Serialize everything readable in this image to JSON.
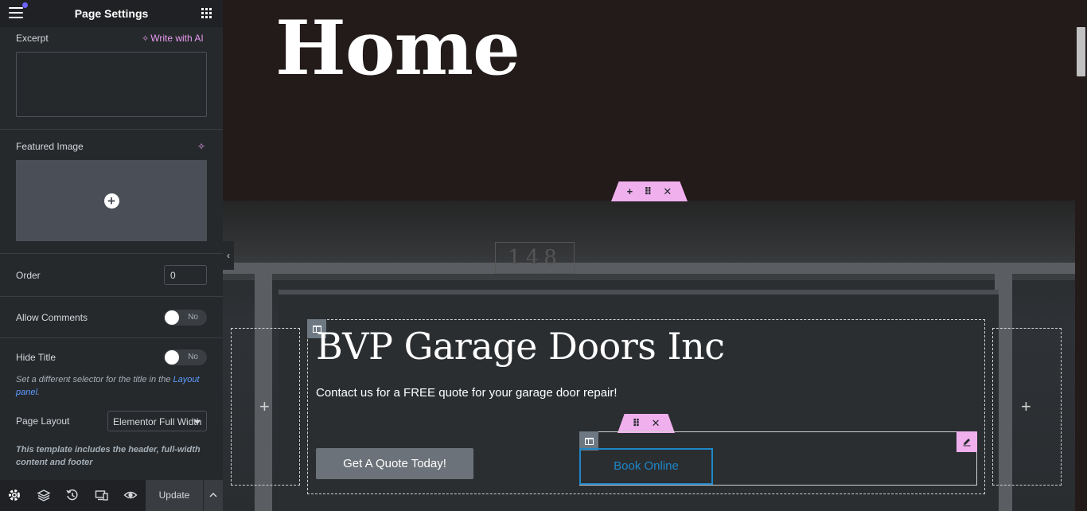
{
  "sidebar": {
    "header": {
      "title": "Page Settings"
    },
    "excerpt": {
      "label": "Excerpt",
      "ai_link": "Write with AI",
      "value": ""
    },
    "featured_image": {
      "label": "Featured Image"
    },
    "order": {
      "label": "Order",
      "value": "0"
    },
    "allow_comments": {
      "label": "Allow Comments",
      "state": "No"
    },
    "hide_title": {
      "label": "Hide Title",
      "state": "No"
    },
    "hide_title_note": {
      "text_before": "Set a different selector for the title in the ",
      "link": "Layout panel",
      "text_after": "."
    },
    "page_layout": {
      "label": "Page Layout",
      "selected": "Elementor Full Width"
    },
    "page_layout_note": "This template includes the header, full-width content and footer",
    "footer": {
      "update_label": "Update"
    }
  },
  "canvas": {
    "home_title": "Home",
    "hero": {
      "heading": "BVP Garage Doors Inc",
      "subtext": "Contact us for a FREE quote for your garage door repair!",
      "quote_button": "Get A Quote Today!",
      "book_button": "Book Online",
      "plaque_number": "148"
    }
  },
  "colors": {
    "sidebar_bg": "#26292c",
    "canvas_bg": "#231a1a",
    "accent_pink": "#f0b0ee",
    "ai_purple": "#e79cf0",
    "link_blue": "#1e87c8"
  },
  "icons": [
    "hamburger-icon",
    "apps-grid-icon",
    "sparkle-icon",
    "add-circle-icon",
    "settings-icon",
    "layers-icon",
    "history-icon",
    "responsive-icon",
    "preview-eye-icon",
    "chevron-up-icon",
    "chevron-left-icon",
    "plus-icon",
    "drag-handle-icon",
    "close-icon",
    "column-icon",
    "pencil-icon"
  ]
}
